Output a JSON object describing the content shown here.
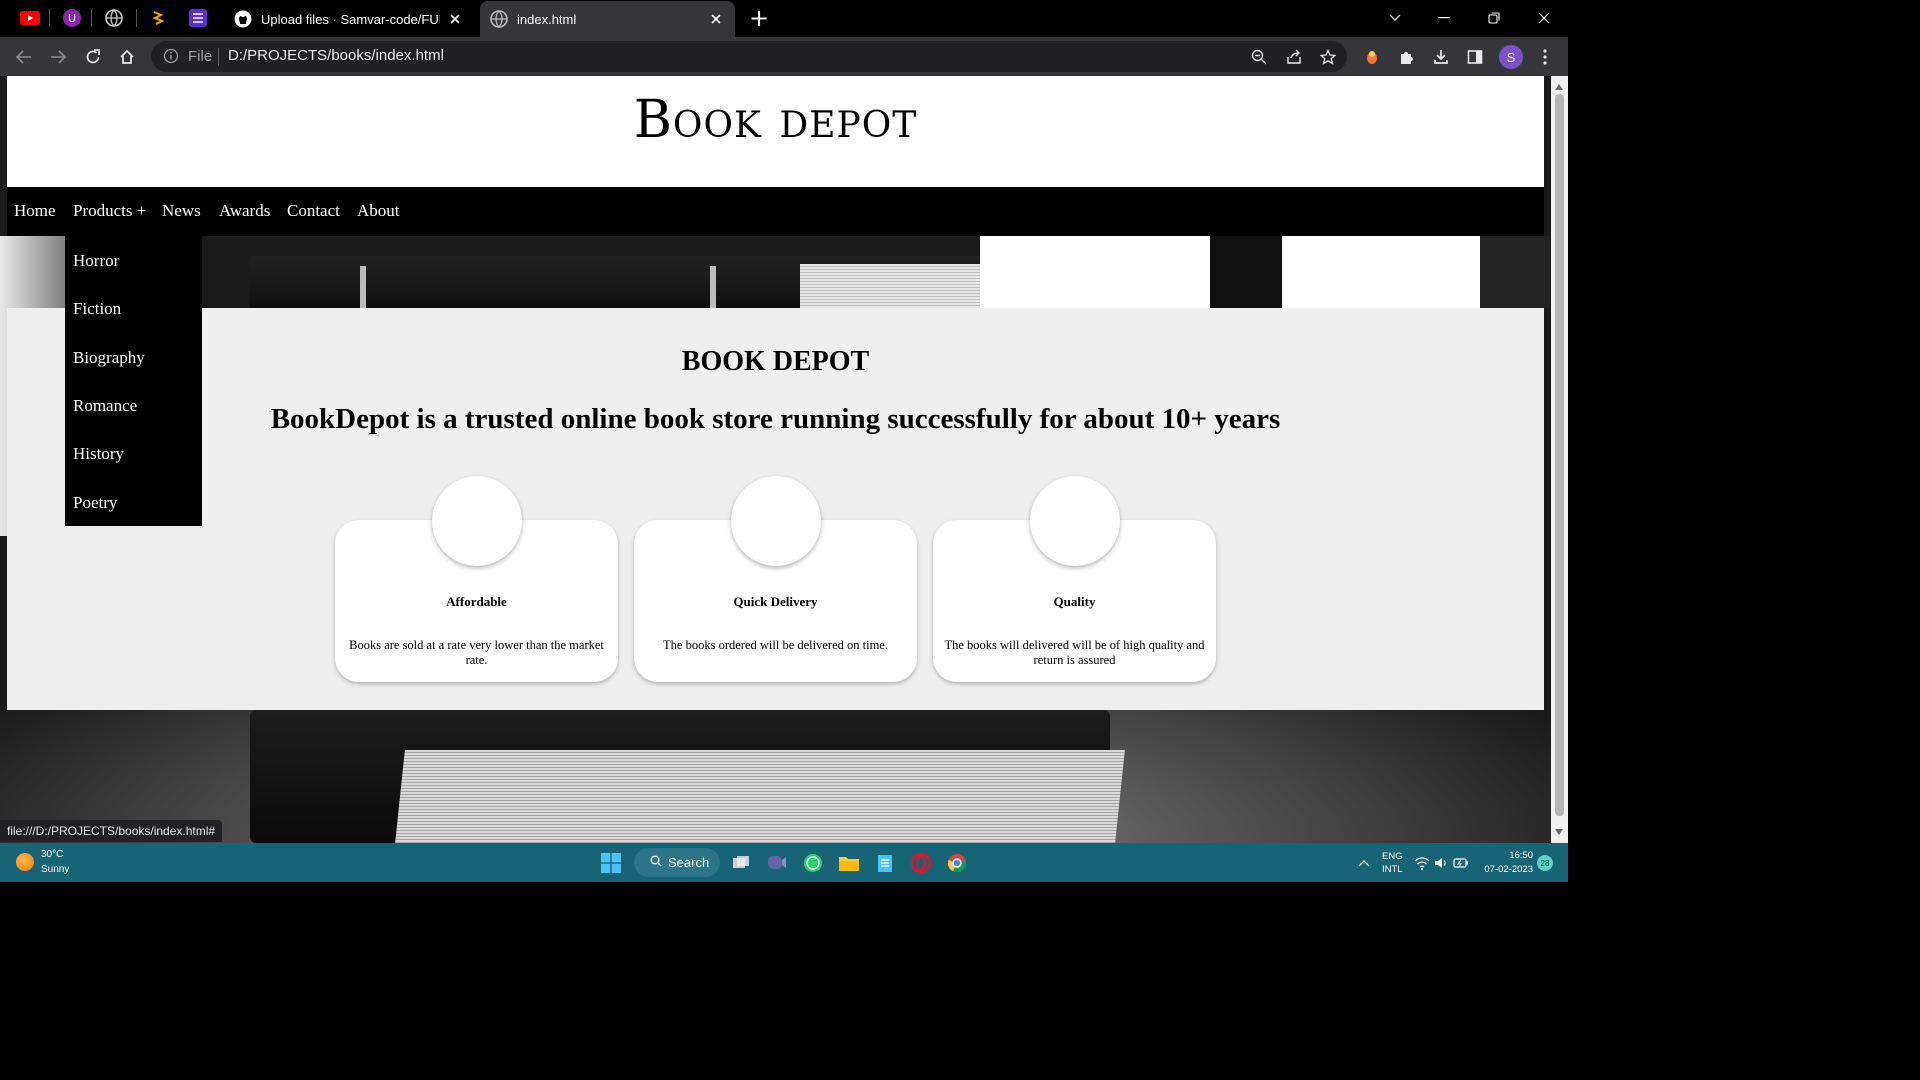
{
  "browser": {
    "tabs": [
      {
        "title": "Upload files · Samvar-code/FULL_ST",
        "favicon": "github-icon",
        "active": false
      },
      {
        "title": "index.html",
        "favicon": "globe-icon",
        "active": true
      }
    ],
    "pinned_tabs": [
      "youtube-icon",
      "ublock-icon",
      "globe-icon",
      "amazon-icon",
      "list-icon"
    ],
    "new_tab_symbol": "+"
  },
  "toolbar": {
    "scheme_label": "File",
    "url": "D:/PROJECTS/books/index.html",
    "profile_initial": "S"
  },
  "site": {
    "title": "Book depot",
    "nav": [
      {
        "label": "Home"
      },
      {
        "label": "Products +"
      },
      {
        "label": "News"
      },
      {
        "label": "Awards"
      },
      {
        "label": "Contact"
      },
      {
        "label": "About"
      }
    ],
    "dropdown": [
      "Horror",
      "Fiction",
      "Biography",
      "Romance",
      "History",
      "Poetry"
    ],
    "main": {
      "heading": "BOOK DEPOT",
      "tagline": "BookDepot is a trusted online book store running successfully for about 10+ years",
      "cards": [
        {
          "title": "Affordable",
          "text": "Books are sold at a rate very lower than the market rate."
        },
        {
          "title": "Quick Delivery",
          "text": "The books ordered will be delivered on time."
        },
        {
          "title": "Quality",
          "text": "The books will delivered will be of high quality and return is assured"
        }
      ]
    }
  },
  "status_bar": {
    "text": "file:///D:/PROJECTS/books/index.html#"
  },
  "taskbar": {
    "weather_temp": "30°C",
    "weather_condition": "Sunny",
    "search_label": "Search",
    "lang_line1": "ENG",
    "lang_line2": "INTL",
    "time": "16:50",
    "date": "07-02-2023",
    "notification_count": "28"
  },
  "colors": {
    "nav_bg": "#000000",
    "content_bg": "#efefef",
    "taskbar_bg": "#176477",
    "chrome_toolbar": "#35363a"
  }
}
